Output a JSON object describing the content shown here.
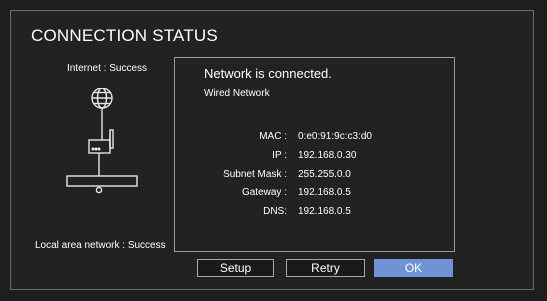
{
  "dialog": {
    "title": "CONNECTION STATUS",
    "internet_status": "Internet : Success",
    "lan_status": "Local area network : Success"
  },
  "status": {
    "heading": "Network is connected.",
    "network_type": "Wired Network",
    "rows": [
      {
        "label": "MAC :",
        "value": "0:e0:91:9c:c3:d0"
      },
      {
        "label": "IP :",
        "value": "192.168.0.30"
      },
      {
        "label": "Subnet Mask :",
        "value": "255.255.0.0"
      },
      {
        "label": "Gateway :",
        "value": "192.168.0.5"
      },
      {
        "label": "DNS:",
        "value": "192.168.0.5"
      }
    ]
  },
  "buttons": {
    "setup": "Setup",
    "retry": "Retry",
    "ok": "OK"
  },
  "colors": {
    "background": "#1e1e1e",
    "selected_button": "#6f93d6",
    "text": "#ffffff"
  },
  "icons": [
    "globe-icon",
    "router-icon",
    "set-top-box-icon"
  ]
}
